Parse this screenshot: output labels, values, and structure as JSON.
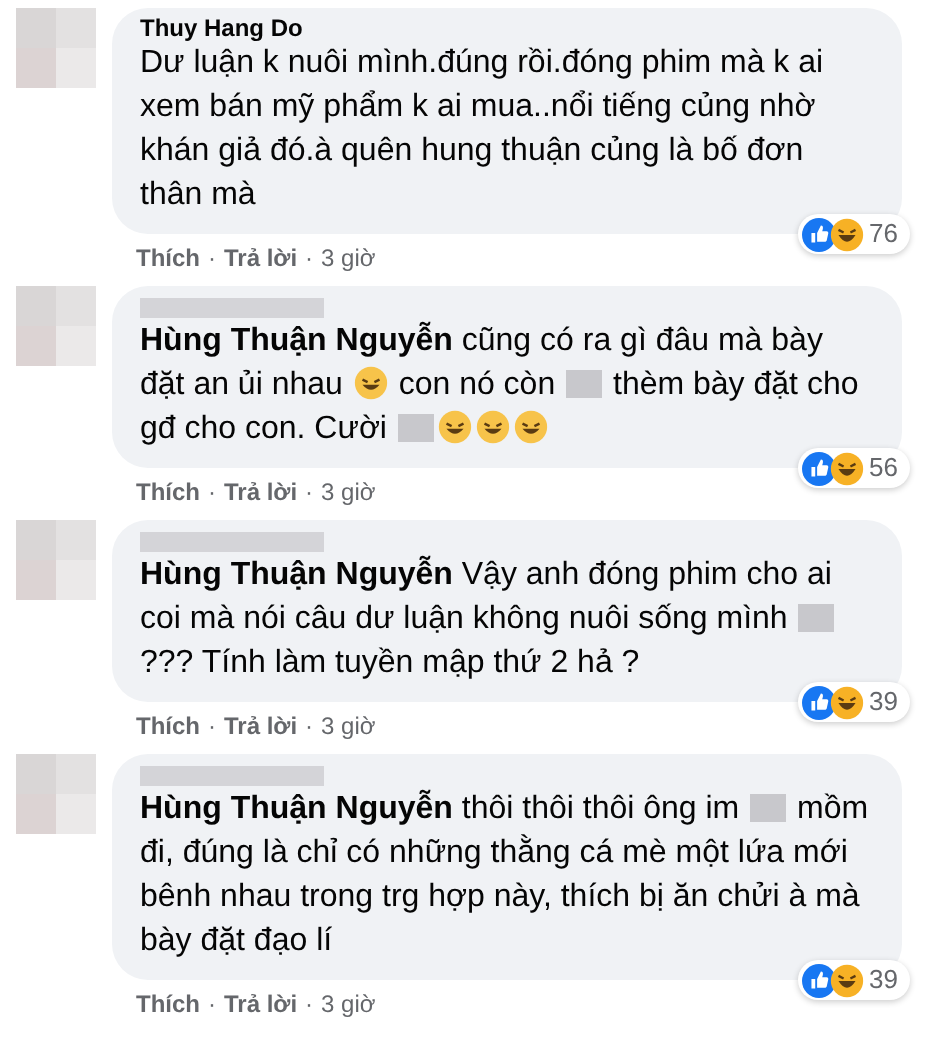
{
  "separator": "·",
  "comments": [
    {
      "author": "Thuy Hang Do",
      "body": [
        {
          "kind": "text",
          "text": "Dư luận k nuôi mình.đúng rồi.đóng phim mà k ai xem bán mỹ phẩm k ai mua..nổi tiếng củng nhờ khán giả đó.à quên hung thuận củng là bố đơn thân mà"
        }
      ],
      "reactions": "76",
      "actions": [
        "Thích",
        "Trả lời"
      ],
      "time": "3 giờ"
    },
    {
      "body": [
        {
          "kind": "text",
          "text": "**Hùng Thuận Nguyễn** cũng có ra gì đâu mà bày đặt an ủi nhau "
        },
        {
          "kind": "emoji"
        },
        {
          "kind": "text",
          "text": " con nó còn "
        },
        {
          "kind": "blur"
        },
        {
          "kind": "text",
          "text": " thèm bày đặt cho gđ cho con. Cười "
        },
        {
          "kind": "blur"
        },
        {
          "kind": "emoji"
        },
        {
          "kind": "emoji"
        },
        {
          "kind": "emoji"
        }
      ],
      "reactions": "56",
      "actions": [
        "Thích",
        "Trả lời"
      ],
      "time": "3 giờ"
    },
    {
      "body": [
        {
          "kind": "text",
          "text": "**Hùng Thuận Nguyễn** Vậy anh đóng phim cho ai coi mà nói câu dư luận không nuôi sống mình "
        },
        {
          "kind": "blur"
        },
        {
          "kind": "text",
          "text": " ??? Tính làm tuyền mập thứ 2 hả ?"
        }
      ],
      "reactions": "39",
      "actions": [
        "Thích",
        "Trả lời"
      ],
      "time": "3 giờ"
    },
    {
      "body": [
        {
          "kind": "text",
          "text": "**Hùng Thuận Nguyễn** thôi thôi thôi ông im "
        },
        {
          "kind": "blur"
        },
        {
          "kind": "text",
          "text": " mồm đi, đúng là chỉ có những thằng cá mè một lứa mới bênh nhau trong trg hợp này, thích bị ăn chửi à mà bày đặt đạo lí"
        }
      ],
      "reactions": "39",
      "actions": [
        "Thích",
        "Trả lời"
      ],
      "time": "3 giờ"
    }
  ]
}
